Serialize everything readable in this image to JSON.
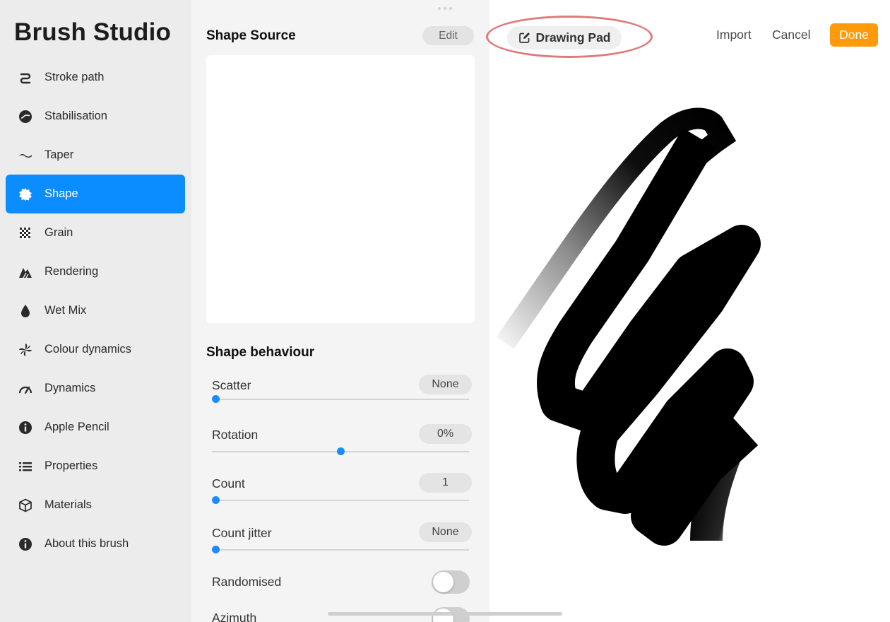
{
  "app_title": "Brush Studio",
  "sidebar": {
    "items": [
      {
        "label": "Stroke path",
        "icon": "stroke-path-icon",
        "active": false
      },
      {
        "label": "Stabilisation",
        "icon": "stabilisation-icon",
        "active": false
      },
      {
        "label": "Taper",
        "icon": "taper-icon",
        "active": false
      },
      {
        "label": "Shape",
        "icon": "shape-icon",
        "active": true
      },
      {
        "label": "Grain",
        "icon": "grain-icon",
        "active": false
      },
      {
        "label": "Rendering",
        "icon": "rendering-icon",
        "active": false
      },
      {
        "label": "Wet Mix",
        "icon": "wet-mix-icon",
        "active": false
      },
      {
        "label": "Colour dynamics",
        "icon": "colour-dynamics-icon",
        "active": false
      },
      {
        "label": "Dynamics",
        "icon": "dynamics-icon",
        "active": false
      },
      {
        "label": "Apple Pencil",
        "icon": "apple-pencil-icon",
        "active": false
      },
      {
        "label": "Properties",
        "icon": "properties-icon",
        "active": false
      },
      {
        "label": "Materials",
        "icon": "materials-icon",
        "active": false
      },
      {
        "label": "About this brush",
        "icon": "info-icon",
        "active": false
      }
    ]
  },
  "panel": {
    "shape_source_title": "Shape Source",
    "edit_label": "Edit",
    "shape_behaviour_title": "Shape behaviour",
    "settings": {
      "scatter": {
        "label": "Scatter",
        "value": "None",
        "slider_fraction": 0.0
      },
      "rotation": {
        "label": "Rotation",
        "value": "0%",
        "slider_fraction": 0.5
      },
      "count": {
        "label": "Count",
        "value": "1",
        "slider_fraction": 0.0
      },
      "count_jitter": {
        "label": "Count jitter",
        "value": "None",
        "slider_fraction": 0.0
      }
    },
    "randomised": {
      "label": "Randomised",
      "on": false
    },
    "azimuth": {
      "label": "Azimuth",
      "on": false
    }
  },
  "drawing_pad": {
    "label": "Drawing Pad",
    "icon": "edit-icon"
  },
  "top_actions": {
    "import_label": "Import",
    "cancel_label": "Cancel",
    "done_label": "Done"
  },
  "colors": {
    "accent_blue": "#0b8cff",
    "done_orange": "#ff9a0a",
    "highlight_red": "#e07a7a"
  }
}
